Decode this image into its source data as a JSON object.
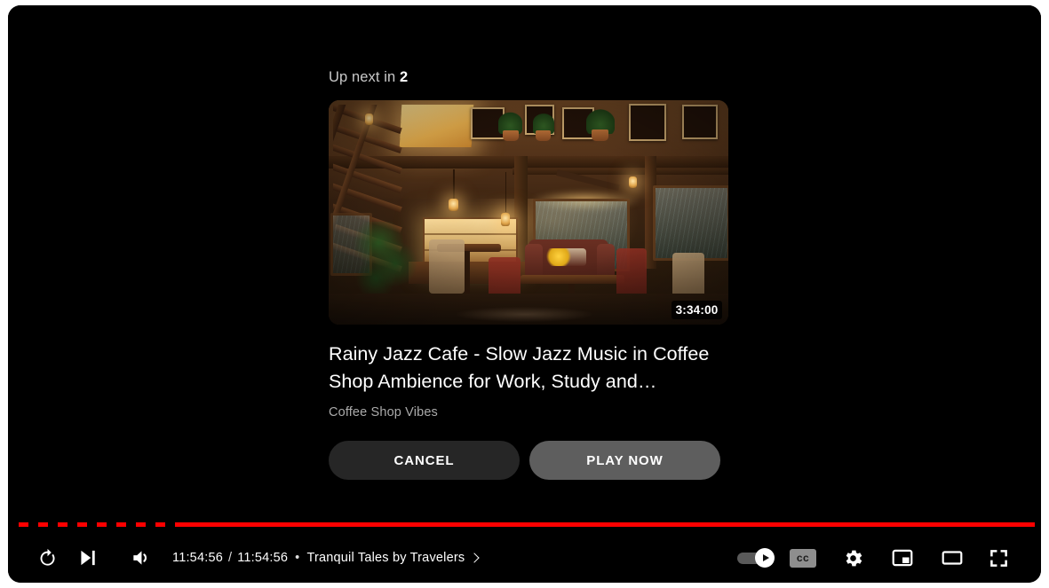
{
  "player": {
    "upnext": {
      "label_prefix": "Up next in",
      "countdown": "2",
      "thumbnail_duration": "3:34:00",
      "video_title": "Rainy Jazz Cafe - Slow Jazz Music in Coffee Shop Ambience for Work, Study and…",
      "channel_name": "Coffee Shop Vibes",
      "cancel_label": "CANCEL",
      "play_now_label": "PLAY NOW",
      "thumbnail_alt": "cozy-wooden-coffee-shop-interior-rainy-windows"
    },
    "controls": {
      "replay_icon": "replay-icon",
      "next_icon": "next-video-icon",
      "volume_icon": "volume-high-icon",
      "current_time": "11:54:56",
      "total_time": "11:54:56",
      "time_separator": "/",
      "chapter_bullet": "•",
      "chapter_title": "Tranquil Tales by Travelers",
      "chapter_chevron_icon": "chevron-right-icon",
      "autoplay_icon": "autoplay-toggle-icon",
      "autoplay_state": "on",
      "subtitles_label": "cc",
      "subtitles_icon": "closed-captions-icon",
      "settings_icon": "gear-icon",
      "miniplayer_icon": "miniplayer-icon",
      "theater_icon": "theater-mode-icon",
      "fullscreen_icon": "fullscreen-icon"
    },
    "progress": {
      "played_percent": 100,
      "played_color": "#ff0000",
      "track_color": "#3a3a3a"
    }
  }
}
